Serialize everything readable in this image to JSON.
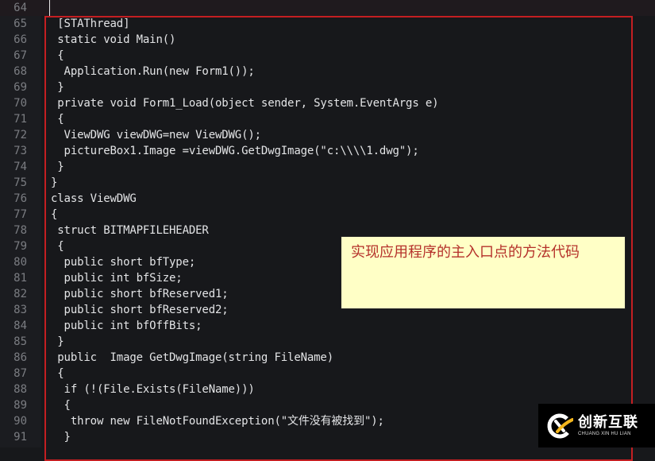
{
  "editor": {
    "current_line": 64,
    "lines": [
      {
        "n": "64",
        "text": ""
      },
      {
        "n": "65",
        "text": " [STAThread]"
      },
      {
        "n": "66",
        "text": " static void Main()"
      },
      {
        "n": "67",
        "text": " {"
      },
      {
        "n": "68",
        "text": "  Application.Run(new Form1());"
      },
      {
        "n": "69",
        "text": " }"
      },
      {
        "n": "70",
        "text": " private void Form1_Load(object sender, System.EventArgs e)"
      },
      {
        "n": "71",
        "text": " {"
      },
      {
        "n": "72",
        "text": "  ViewDWG viewDWG=new ViewDWG();"
      },
      {
        "n": "73",
        "text": "  pictureBox1.Image =viewDWG.GetDwgImage(\"c:\\\\\\\\1.dwg\");"
      },
      {
        "n": "74",
        "text": " }"
      },
      {
        "n": "75",
        "text": "}"
      },
      {
        "n": "76",
        "text": "class ViewDWG"
      },
      {
        "n": "77",
        "text": "{"
      },
      {
        "n": "78",
        "text": " struct BITMAPFILEHEADER"
      },
      {
        "n": "79",
        "text": " {"
      },
      {
        "n": "80",
        "text": "  public short bfType;"
      },
      {
        "n": "81",
        "text": "  public int bfSize;"
      },
      {
        "n": "82",
        "text": "  public short bfReserved1;"
      },
      {
        "n": "83",
        "text": "  public short bfReserved2;"
      },
      {
        "n": "84",
        "text": "  public int bfOffBits;"
      },
      {
        "n": "85",
        "text": " }"
      },
      {
        "n": "86",
        "text": " public  Image GetDwgImage(string FileName)"
      },
      {
        "n": "87",
        "text": " {"
      },
      {
        "n": "88",
        "text": "  if (!(File.Exists(FileName)))"
      },
      {
        "n": "89",
        "text": "  {"
      },
      {
        "n": "90",
        "text": "   throw new FileNotFoundException(\"文件没有被找到\");"
      },
      {
        "n": "91",
        "text": "  }"
      }
    ]
  },
  "annotation": {
    "text": "实现应用程序的主入口点的方法代码",
    "box_color": "#c41f22",
    "note_background": "#ffffc6",
    "note_text_color": "#b5312b"
  },
  "watermark": {
    "name_cn": "创新互联",
    "name_en": "CHUANG XIN HU LIAN"
  }
}
